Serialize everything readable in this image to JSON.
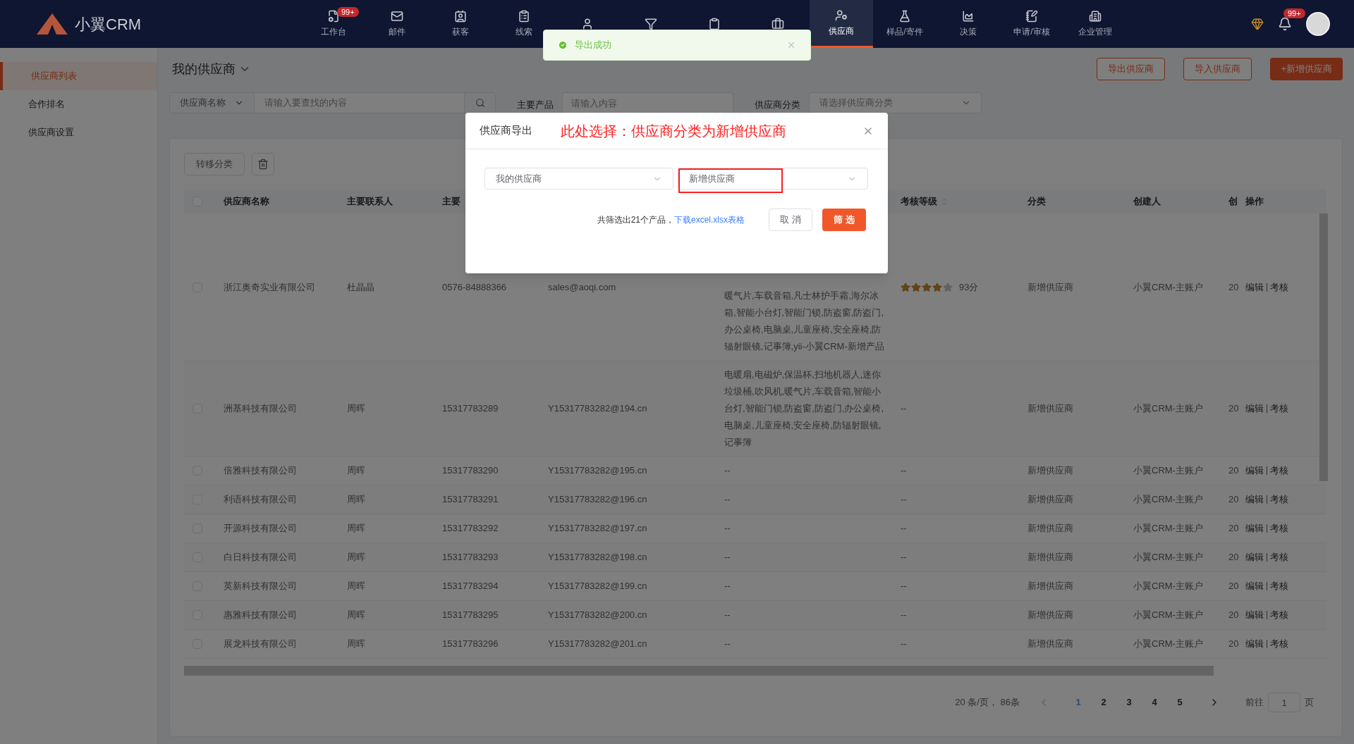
{
  "brand": {
    "name": "小翼CRM"
  },
  "nav": [
    {
      "label": "工作台",
      "badge": "99+",
      "selected": false
    },
    {
      "label": "邮件",
      "selected": false
    },
    {
      "label": "获客",
      "selected": false
    },
    {
      "label": "线索",
      "selected": false
    },
    {
      "selected": false
    },
    {
      "selected": false
    },
    {
      "selected": false
    },
    {
      "selected": false
    },
    {
      "label": "供应商",
      "selected": true
    },
    {
      "label": "样品/寄件",
      "selected": false
    },
    {
      "label": "决策",
      "selected": false
    },
    {
      "label": "申请/审核",
      "selected": false
    },
    {
      "label": "企业管理",
      "selected": false
    }
  ],
  "notifications": {
    "badge": "99+"
  },
  "toast": {
    "text": "导出成功"
  },
  "sidebar": {
    "items": [
      {
        "label": "供应商列表",
        "selected": true
      },
      {
        "label": "合作排名",
        "selected": false
      },
      {
        "label": "供应商设置",
        "selected": false
      }
    ]
  },
  "header": {
    "title": "我的供应商",
    "buttons": [
      {
        "label": "导出供应商",
        "kind": "outline"
      },
      {
        "label": "导入供应商",
        "kind": "outline"
      },
      {
        "label": "+新增供应商",
        "kind": "solid"
      }
    ]
  },
  "filters": {
    "search_by": "供应商名称",
    "search_placeholder": "请输入要查找的内容",
    "product_label": "主要产品",
    "product_placeholder": "请输入内容",
    "category_label": "供应商分类",
    "category_placeholder": "请选择供应商分类"
  },
  "toolbar": {
    "transfer": "转移分类"
  },
  "table": {
    "all_checked": false,
    "columns": [
      "供应商名称",
      "主要联系人",
      "主要",
      "考核等级",
      "分类",
      "创建人",
      "创",
      "操作"
    ],
    "rows": [
      {
        "checked": false,
        "name": "浙江奥奇实业有限公司",
        "contact": "杜晶晶",
        "phone": "0576-84888366",
        "email": "sales@aoqi.com",
        "products": "暖气片,车载音箱,凡士林护手霜,海尔冰箱,智能小台灯,智能门锁,防盗窗,防盗门,办公桌椅,电脑桌,儿童座椅,安全座椅,防辐射眼镜,记事簿,yii-小翼CRM-新增产品",
        "stars": 4,
        "score": "93分",
        "category": "新增供应商",
        "creator": "小翼CRM-主账户",
        "column_9": "20",
        "edit": "编辑",
        "review": "考核"
      },
      {
        "checked": false,
        "name": "洲基科技有限公司",
        "contact": "周晖",
        "phone": "15317783289",
        "email": "Y15317783282@194.cn",
        "products": "电暖扇,电磁炉,保温杯,扫地机器人,迷你垃圾桶,吹风机,暖气片,车载音箱,智能小台灯,智能门锁,防盗窗,防盗门,办公桌椅,电脑桌,儿童座椅,安全座椅,防辐射眼镜,记事簿",
        "rating": "--",
        "category": "新增供应商",
        "creator": "小翼CRM-主账户",
        "column_9": "20",
        "edit": "编辑",
        "review": "考核"
      },
      {
        "checked": false,
        "name": "倍雅科技有限公司",
        "contact": "周晖",
        "phone": "15317783290",
        "email": "Y15317783282@195.cn",
        "products": "--",
        "rating": "--",
        "category": "新增供应商",
        "creator": "小翼CRM-主账户",
        "column_9": "20",
        "edit": "编辑",
        "review": "考核"
      },
      {
        "checked": false,
        "name": "利语科技有限公司",
        "contact": "周晖",
        "phone": "15317783291",
        "email": "Y15317783282@196.cn",
        "products": "--",
        "rating": "--",
        "category": "新增供应商",
        "creator": "小翼CRM-主账户",
        "column_9": "20",
        "edit": "编辑",
        "review": "考核"
      },
      {
        "checked": false,
        "name": "开源科技有限公司",
        "contact": "周晖",
        "phone": "15317783292",
        "email": "Y15317783282@197.cn",
        "products": "--",
        "rating": "--",
        "category": "新增供应商",
        "creator": "小翼CRM-主账户",
        "column_9": "20",
        "edit": "编辑",
        "review": "考核"
      },
      {
        "checked": false,
        "name": "白日科技有限公司",
        "contact": "周晖",
        "phone": "15317783293",
        "email": "Y15317783282@198.cn",
        "products": "--",
        "rating": "--",
        "category": "新增供应商",
        "creator": "小翼CRM-主账户",
        "column_9": "20",
        "edit": "编辑",
        "review": "考核"
      },
      {
        "checked": false,
        "name": "英新科技有限公司",
        "contact": "周晖",
        "phone": "15317783294",
        "email": "Y15317783282@199.cn",
        "products": "--",
        "rating": "--",
        "category": "新增供应商",
        "creator": "小翼CRM-主账户",
        "column_9": "20",
        "edit": "编辑",
        "review": "考核"
      },
      {
        "checked": false,
        "name": "惠雅科技有限公司",
        "contact": "周晖",
        "phone": "15317783295",
        "email": "Y15317783282@200.cn",
        "products": "--",
        "rating": "--",
        "category": "新增供应商",
        "creator": "小翼CRM-主账户",
        "column_9": "20",
        "edit": "编辑",
        "review": "考核"
      },
      {
        "checked": false,
        "name": "展龙科技有限公司",
        "contact": "周晖",
        "phone": "15317783296",
        "email": "Y15317783282@201.cn",
        "products": "--",
        "rating": "--",
        "category": "新增供应商",
        "creator": "小翼CRM-主账户",
        "column_9": "20",
        "edit": "编辑",
        "review": "考核"
      }
    ]
  },
  "pagination": {
    "summary": "20 条/页， 86条",
    "pages": [
      {
        "label": "1",
        "selected": true
      },
      {
        "label": "2",
        "selected": false
      },
      {
        "label": "3",
        "selected": false
      },
      {
        "label": "4",
        "selected": false
      },
      {
        "label": "5",
        "selected": false
      }
    ],
    "goto_label": "前往",
    "goto_value": "1",
    "page_suffix": "页"
  },
  "dialog": {
    "title": "供应商导出",
    "annotation": "此处选择：供应商分类为新增供应商",
    "select_1": "我的供应商",
    "select_2": "新增供应商",
    "summary": "共筛选出21个产品，",
    "link": "下载excel.xlsx表格",
    "cancel": "取 消",
    "confirm": "筛 选"
  }
}
